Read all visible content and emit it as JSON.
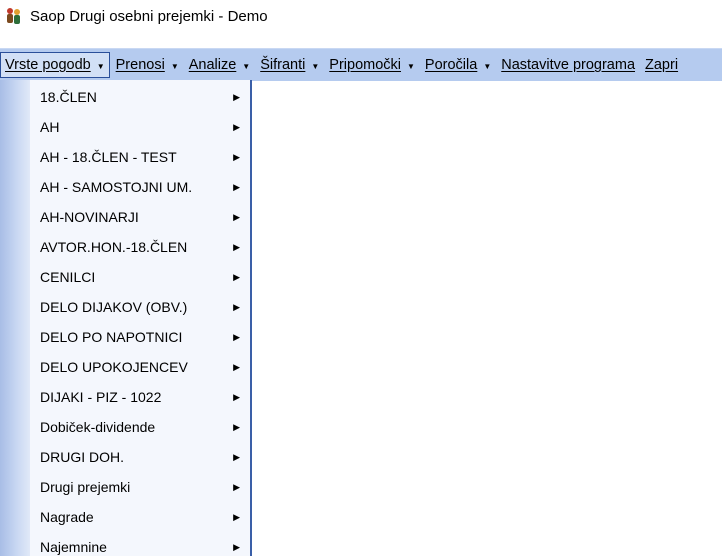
{
  "window": {
    "title": "Saop Drugi osebni prejemki - Demo",
    "icon": "people-icon"
  },
  "menubar": {
    "items": [
      {
        "label": "Vrste pogodb",
        "has_arrow": true,
        "active": true
      },
      {
        "label": "Prenosi",
        "has_arrow": true
      },
      {
        "label": "Analize",
        "has_arrow": true
      },
      {
        "label": "Šifranti",
        "has_arrow": true
      },
      {
        "label": "Pripomočki",
        "has_arrow": true
      },
      {
        "label": "Poročila",
        "has_arrow": true
      },
      {
        "label": "Nastavitve programa",
        "has_arrow": false
      },
      {
        "label": "Zapri",
        "has_arrow": false
      }
    ],
    "arrow_glyph": "▼"
  },
  "dropdown": {
    "submenu_glyph": "▶",
    "items": [
      {
        "label": "18.ČLEN"
      },
      {
        "label": "AH"
      },
      {
        "label": "AH - 18.ČLEN - TEST"
      },
      {
        "label": "AH - SAMOSTOJNI UM."
      },
      {
        "label": "AH-NOVINARJI"
      },
      {
        "label": "AVTOR.HON.-18.ČLEN"
      },
      {
        "label": "CENILCI"
      },
      {
        "label": "DELO DIJAKOV (OBV.)"
      },
      {
        "label": "DELO PO NAPOTNICI"
      },
      {
        "label": "DELO UPOKOJENCEV"
      },
      {
        "label": "DIJAKI - PIZ - 1022"
      },
      {
        "label": "Dobiček-dividende"
      },
      {
        "label": "DRUGI DOH."
      },
      {
        "label": "Drugi prejemki"
      },
      {
        "label": "Nagrade"
      },
      {
        "label": "Najemnine"
      }
    ]
  },
  "colors": {
    "menubar_bg": "#b5cbef",
    "active_border": "#2a4f9a",
    "dropdown_bg": "#f4f7fd",
    "dropdown_border": "#3a5fa8"
  }
}
